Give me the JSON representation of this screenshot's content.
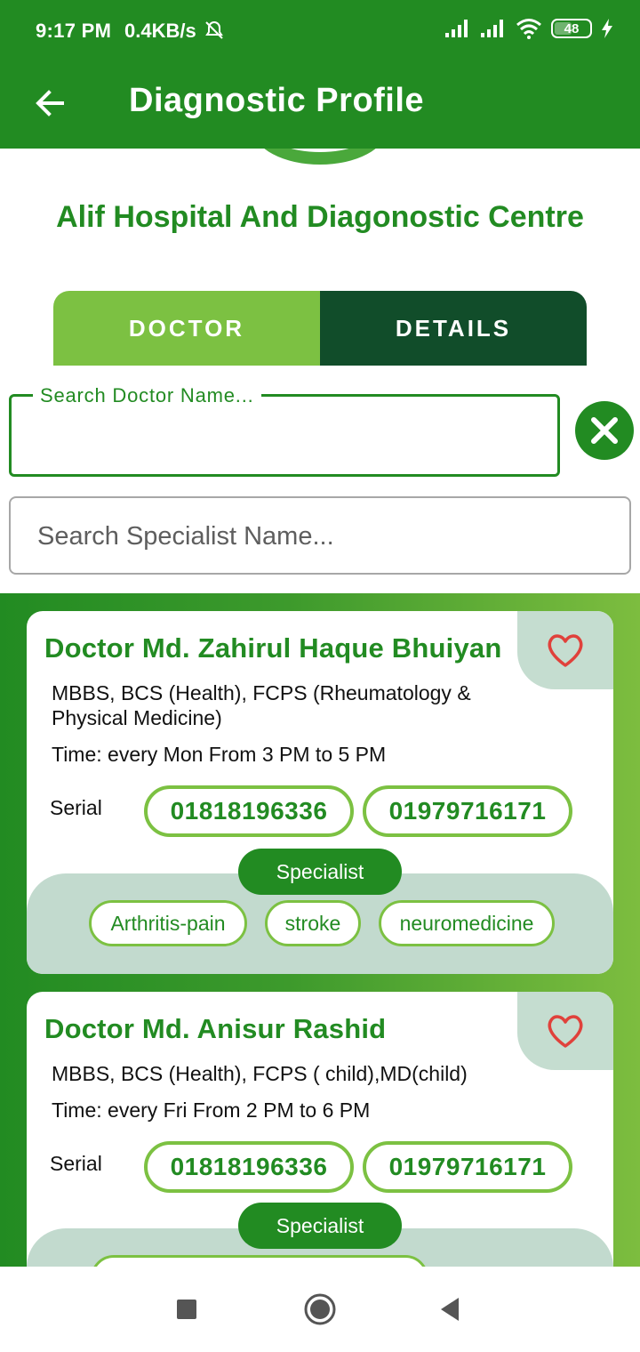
{
  "status_bar": {
    "time": "9:17 PM",
    "network_speed": "0.4KB/s",
    "battery": "48",
    "battery_level_percent": 48,
    "icons": [
      "mute-alarm-icon",
      "signal-icon",
      "signal-icon",
      "wifi-icon",
      "battery-icon",
      "charging-icon"
    ]
  },
  "app_bar": {
    "title": "Diagnostic Profile",
    "back_icon": "arrow-left-icon"
  },
  "hospital": {
    "name": "Alif Hospital And Diagonostic Centre"
  },
  "tabs": [
    {
      "label": "DOCTOR",
      "selected": true
    },
    {
      "label": "DETAILS",
      "selected": false
    }
  ],
  "search": {
    "doctor_label": "Search Doctor Name...",
    "doctor_value": "",
    "specialist_placeholder": "Search Specialist Name..."
  },
  "doctors": [
    {
      "name": "Doctor Md. Zahirul Haque Bhuiyan",
      "degree": "MBBS, BCS (Health), FCPS (Rheumatology & Physical Medicine)",
      "time": "Time: every Mon From 3 PM to 5 PM",
      "serial_label": "Serial",
      "phones": [
        "01818196336",
        "01979716171"
      ],
      "specialist_label": "Specialist",
      "specialties": [
        "Arthritis-pain",
        "stroke",
        "neuromedicine"
      ]
    },
    {
      "name": "Doctor Md. Anisur Rashid",
      "degree": "MBBS, BCS (Health), FCPS ( child),MD(child)",
      "time": "Time: every Fri From 2 PM to 6 PM",
      "serial_label": "Serial",
      "phones": [
        "01818196336",
        "01979716171"
      ],
      "specialist_label": "Specialist",
      "specialties": []
    }
  ],
  "colors": {
    "primary": "#228B22",
    "accent_light": "#7cc142",
    "tab_dark": "#114d2a",
    "specialist_bg": "#c2dace",
    "favorite_red": "#e0413b"
  }
}
